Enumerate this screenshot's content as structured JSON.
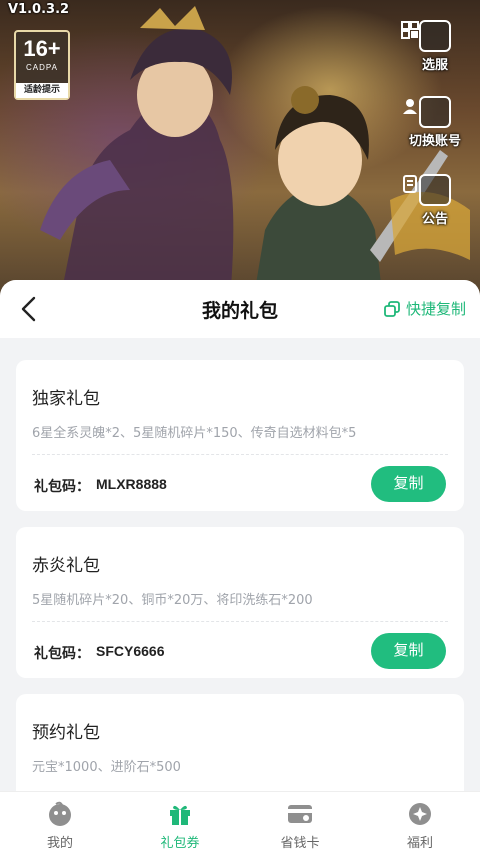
{
  "overlay": {
    "version": "V1.0.3.2",
    "age_rating": "16+",
    "age_org": "CADPA",
    "age_tip": "适龄提示",
    "side_buttons": [
      {
        "label": "选服",
        "icon": "server-select-icon"
      },
      {
        "label": "切换账号",
        "icon": "switch-account-icon"
      },
      {
        "label": "公告",
        "icon": "notice-icon"
      }
    ]
  },
  "header": {
    "title": "我的礼包",
    "quick_copy_label": "快捷复制"
  },
  "gift_packs": [
    {
      "name": "独家礼包",
      "contents": "6星全系灵魄*2、5星随机碎片*150、传奇自选材料包*5",
      "code_label": "礼包码：",
      "code": "MLXR8888",
      "copy_label": "复制"
    },
    {
      "name": "赤炎礼包",
      "contents": "5星随机碎片*20、铜币*20万、将印洗练石*200",
      "code_label": "礼包码：",
      "code": "SFCY6666",
      "copy_label": "复制"
    },
    {
      "name": "预约礼包",
      "contents": "元宝*1000、进阶石*500"
    }
  ],
  "bottom_nav": [
    {
      "label": "我的",
      "icon": "profile-icon"
    },
    {
      "label": "礼包券",
      "icon": "gift-icon",
      "active": true
    },
    {
      "label": "省钱卡",
      "icon": "card-icon"
    },
    {
      "label": "福利",
      "icon": "welfare-icon"
    }
  ],
  "colors": {
    "accent": "#1fb879",
    "button": "#21bd7f"
  }
}
